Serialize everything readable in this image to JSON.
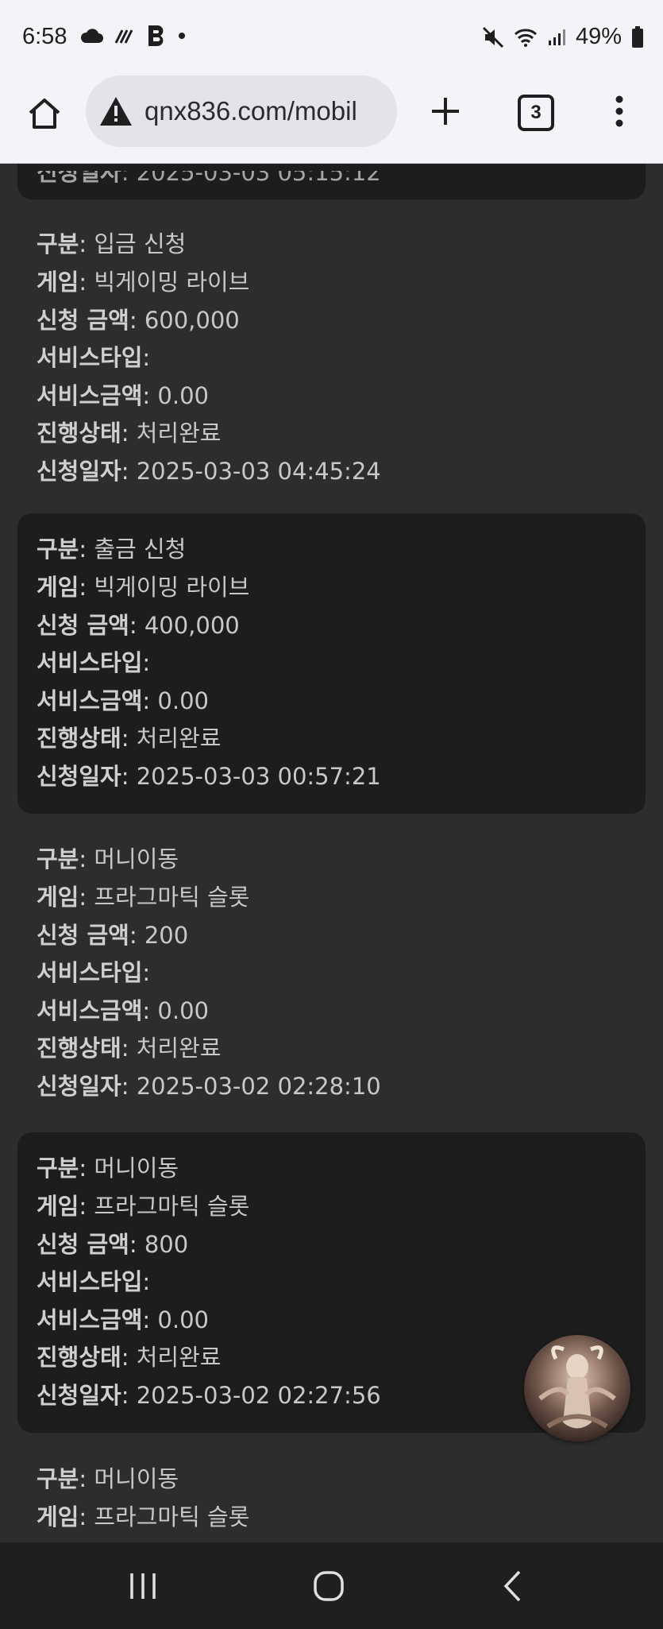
{
  "status_bar": {
    "time": "6:58",
    "battery": "49%"
  },
  "browser": {
    "url": "qnx836.com/mobil",
    "tab_count": "3"
  },
  "labels": {
    "type": "구분",
    "game": "게임",
    "amount": "신청 금액",
    "service_type": "서비스타입",
    "service_amount": "서비스금액",
    "status": "진행상태",
    "date": "신청일자"
  },
  "records": [
    {
      "type": "입금 신청",
      "game": "빅게이밍 라이브",
      "amount": "600,000",
      "service_type": "",
      "service_amount": "0.00",
      "status": "처리완료",
      "date": "2025-03-03 04:45:24"
    },
    {
      "type": "출금 신청",
      "game": "빅게이밍 라이브",
      "amount": "400,000",
      "service_type": "",
      "service_amount": "0.00",
      "status": "처리완료",
      "date": "2025-03-03 00:57:21"
    },
    {
      "type": "머니이동",
      "game": "프라그마틱 슬롯",
      "amount": "200",
      "service_type": "",
      "service_amount": "0.00",
      "status": "처리완료",
      "date": "2025-03-02 02:28:10"
    },
    {
      "type": "머니이동",
      "game": "프라그마틱 슬롯",
      "amount": "800",
      "service_type": "",
      "service_amount": "0.00",
      "status": "처리완료",
      "date": "2025-03-02 02:27:56"
    },
    {
      "type": "머니이동",
      "game": "프라그마틱 슬롯"
    }
  ],
  "colors": {
    "page_bg": "#2d2d2d",
    "card_bg": "#1d1d1d",
    "chrome_bg": "#f4f4f8"
  }
}
